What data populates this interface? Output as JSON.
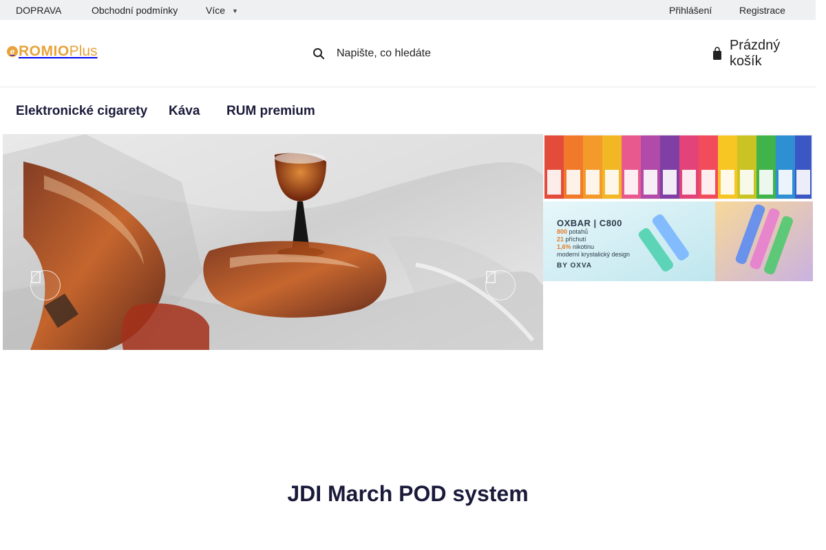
{
  "topbar": {
    "links": [
      "DOPRAVA",
      "Obchodní podmínky"
    ],
    "more_label": "Více",
    "login": "Přihlášení",
    "register": "Registrace"
  },
  "header": {
    "logo_main": "ROMIO",
    "logo_plus": "Plus",
    "logo_mark": "e",
    "search_placeholder": "Napište, co hledáte",
    "cart_label": "Prázdný košík"
  },
  "nav": {
    "items": [
      "Elektronické cigarety",
      "Káva",
      "RUM premium"
    ]
  },
  "banner": {
    "oxbar_title": "OXBAR | C800",
    "oxbar_line1_value": "800",
    "oxbar_line1_text": "potahů",
    "oxbar_line2_value": "21",
    "oxbar_line2_text": "příchutí",
    "oxbar_line3_value": "1,6%",
    "oxbar_line3_text": "nikotinu",
    "oxbar_line4": "moderní krystalický design",
    "oxbar_by": "BY OXVA"
  },
  "section": {
    "title": "JDI March POD system"
  },
  "colors": {
    "brand": "#e8a33a",
    "topbar_bg": "#eef0f2",
    "nav_text": "#1a1a3a"
  },
  "icons": {
    "search": "search-icon",
    "cart": "cart-icon",
    "prev": "chevron-left-icon",
    "next": "chevron-right-icon",
    "more": "chevron-down-icon"
  }
}
